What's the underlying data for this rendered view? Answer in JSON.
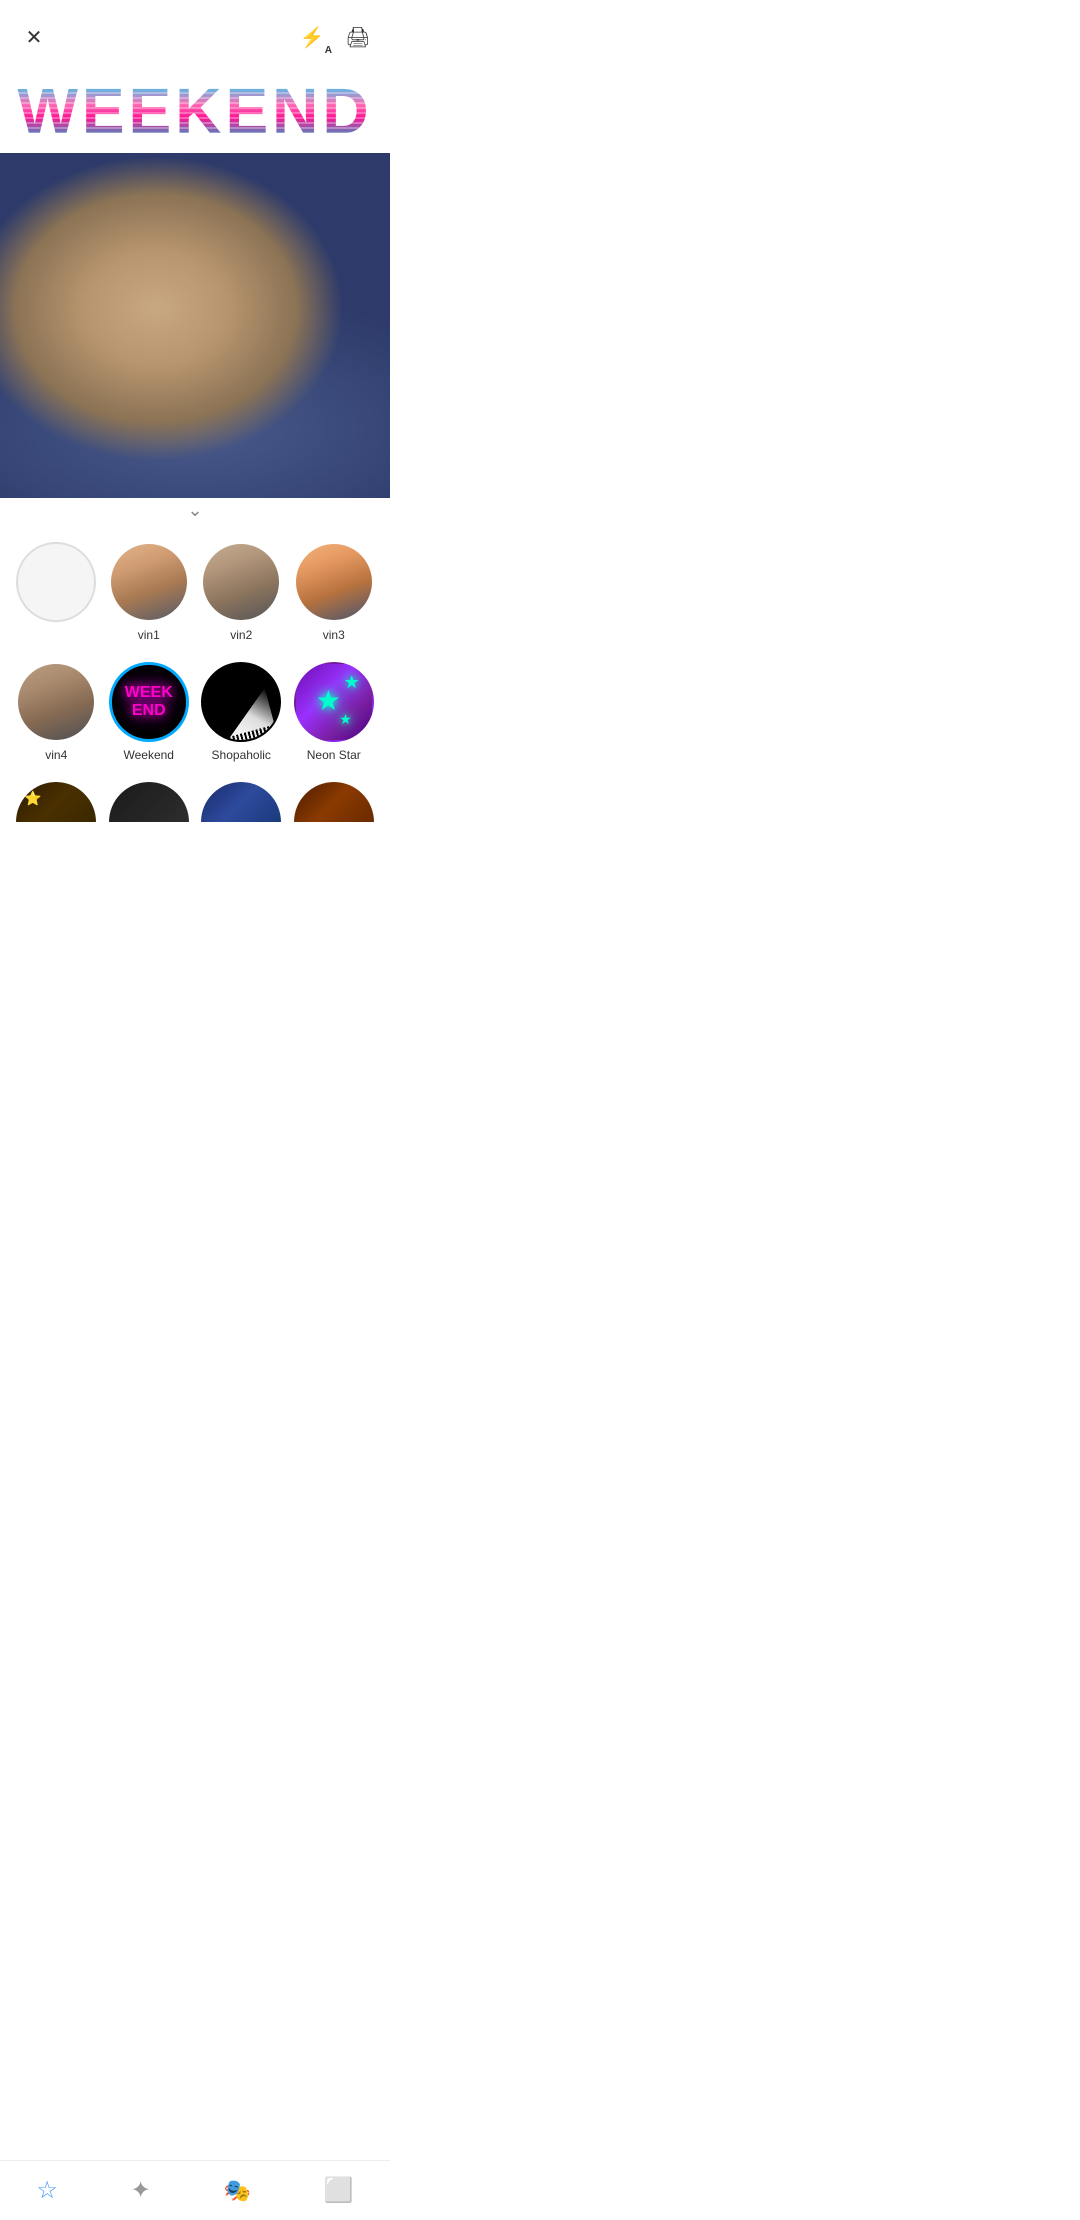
{
  "header": {
    "close_label": "✕",
    "flash_icon": "⚡",
    "auto_label": "A",
    "save_icon": "🖨"
  },
  "title": {
    "text": "WEEKEND"
  },
  "photo": {
    "alt": "Cat photo",
    "chevron": "∨"
  },
  "filters": {
    "row1": [
      {
        "id": "empty",
        "label": "",
        "type": "empty"
      },
      {
        "id": "vin1",
        "label": "vin1",
        "type": "portrait",
        "style": "vin1"
      },
      {
        "id": "vin2",
        "label": "vin2",
        "type": "portrait",
        "style": "vin2"
      },
      {
        "id": "vin3",
        "label": "vin3",
        "type": "portrait",
        "style": "vin3"
      }
    ],
    "row2": [
      {
        "id": "vin4",
        "label": "vin4",
        "type": "portrait",
        "style": "vin4"
      },
      {
        "id": "weekend",
        "label": "Weekend",
        "type": "weekend",
        "selected": true
      },
      {
        "id": "shopaholic",
        "label": "Shopaholic",
        "type": "shopaholic"
      },
      {
        "id": "neon-star",
        "label": "Neon Star",
        "type": "neon-star"
      }
    ],
    "row3_partial": [
      {
        "id": "partial1",
        "type": "stars"
      },
      {
        "id": "partial2",
        "type": "dark"
      },
      {
        "id": "partial3",
        "type": "blue"
      },
      {
        "id": "partial4",
        "type": "warm"
      }
    ]
  },
  "bottom_nav": [
    {
      "id": "star",
      "icon": "☆",
      "active": true
    },
    {
      "id": "effects",
      "icon": "✦",
      "active": false
    },
    {
      "id": "stickers",
      "icon": "🎭",
      "active": false
    },
    {
      "id": "frames",
      "icon": "⬜",
      "active": false
    }
  ]
}
